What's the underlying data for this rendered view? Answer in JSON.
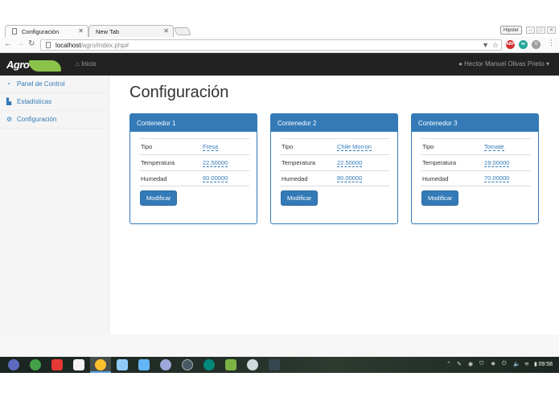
{
  "browser": {
    "tabs": [
      {
        "title": "Configuración",
        "active": true
      },
      {
        "title": "New Tab",
        "active": false
      }
    ],
    "profile_name": "Hipster",
    "url_host": "localhost",
    "url_path": "/agro/index.php#",
    "icons": {
      "back": "arrow-left",
      "forward": "arrow-right",
      "reload": "reload",
      "page": "page",
      "close": "close"
    }
  },
  "site": {
    "logo_text": "Agro",
    "nav_home": "Inicio",
    "user_name": "Hector Manuel Olivas Prieto"
  },
  "sidebar": {
    "items": [
      {
        "label": "Panel de Control",
        "icon": "dashboard-icon"
      },
      {
        "label": "Estadísticas",
        "icon": "chart-icon"
      },
      {
        "label": "Configuración",
        "icon": "gears-icon"
      }
    ]
  },
  "page": {
    "title": "Configuración",
    "button_label": "Modificar",
    "containers": [
      {
        "name": "Contenedor 1",
        "rows": [
          {
            "label": "Tipo",
            "value": "Fresa"
          },
          {
            "label": "Temperatura",
            "value": "22.50000"
          },
          {
            "label": "Humedad",
            "value": "60.00000"
          }
        ]
      },
      {
        "name": "Contenedor 2",
        "rows": [
          {
            "label": "Tipo",
            "value": "Chile Morron"
          },
          {
            "label": "Temperatura",
            "value": "22.50000"
          },
          {
            "label": "Humedad",
            "value": "80.00000"
          }
        ]
      },
      {
        "name": "Contenedor 3",
        "rows": [
          {
            "label": "Tipo",
            "value": "Tomate"
          },
          {
            "label": "Temperatura",
            "value": "19.00000"
          },
          {
            "label": "Humedad",
            "value": "70.00000"
          }
        ]
      }
    ]
  },
  "taskbar": {
    "clock": "09:58"
  },
  "colors": {
    "primary": "#337ab7",
    "navbar": "#222222",
    "logo_green": "#8bc34a"
  }
}
